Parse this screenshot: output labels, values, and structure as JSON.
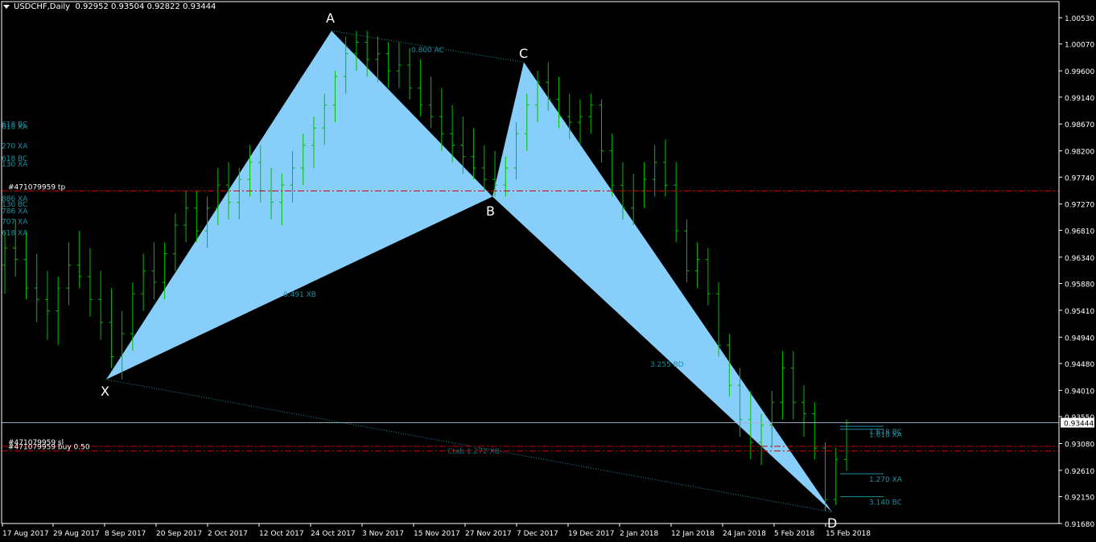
{
  "header": {
    "symbol": "USDCHF,Daily",
    "ohlc": "0.92952 0.93504 0.92822 0.93444"
  },
  "colors": {
    "background": "#000000",
    "candle": "#00c000",
    "pattern_fill": "#87cefa",
    "ratio_text": "#1e8fa0",
    "grid_label": "#ffffff",
    "order_line": "#cc0000",
    "bid_line": "#9fb4c8"
  },
  "price_axis": {
    "min": 0.9168,
    "max": 1.0053,
    "ticks": [
      "1.00530",
      "1.00070",
      "0.99600",
      "0.99140",
      "0.98670",
      "0.98200",
      "0.97740",
      "0.97270",
      "0.96810",
      "0.96340",
      "0.95880",
      "0.95410",
      "0.94940",
      "0.94480",
      "0.94010",
      "0.93550",
      "0.93080",
      "0.92610",
      "0.92150",
      "0.91680"
    ],
    "current_price": "0.93444"
  },
  "time_axis": {
    "labels": [
      "17 Aug 2017",
      "29 Aug 2017",
      "8 Sep 2017",
      "20 Sep 2017",
      "2 Oct 2017",
      "12 Oct 2017",
      "24 Oct 2017",
      "3 Nov 2017",
      "15 Nov 2017",
      "27 Nov 2017",
      "7 Dec 2017",
      "19 Dec 2017",
      "2 Jan 2018",
      "12 Jan 2018",
      "24 Jan 2018",
      "5 Feb 2018",
      "15 Feb 2018"
    ]
  },
  "pattern": {
    "points": [
      {
        "label": "X",
        "price": 0.942
      },
      {
        "label": "A",
        "price": 1.003
      },
      {
        "label": "B",
        "price": 0.974
      },
      {
        "label": "C",
        "price": 0.9975
      },
      {
        "label": "D",
        "price": 0.9188
      }
    ],
    "ratios": {
      "xb": "0.491 XB",
      "ac": "0.800 AC",
      "bd": "3.255 BD"
    },
    "d_levels": [
      {
        "label": "1.618 BC",
        "price": 0.9338
      },
      {
        "label": "1.618 XA",
        "price": 0.9333
      },
      {
        "label": "1.270 XA",
        "price": 0.9255
      },
      {
        "label": "3.140 BC",
        "price": 0.9215
      }
    ],
    "left_levels": [
      {
        "label": "618 BC",
        "price": 0.9868
      },
      {
        "label": "618 XA",
        "price": 0.9864
      },
      {
        "label": "270 XA",
        "price": 0.983
      },
      {
        "label": "618 BC",
        "price": 0.9808
      },
      {
        "label": "130 XA",
        "price": 0.9798
      },
      {
        "label": "886 XA",
        "price": 0.9738
      },
      {
        "label": "130 BC",
        "price": 0.9728
      },
      {
        "label": "786 XA",
        "price": 0.9716
      },
      {
        "label": "707 XA",
        "price": 0.9698
      },
      {
        "label": "618 XA",
        "price": 0.9678
      }
    ],
    "x_extension_label": "Ctab  1.272 XB"
  },
  "orders": [
    {
      "label": "#471079959 tp",
      "price": 0.975
    },
    {
      "label": "#471079959 sl",
      "price": 0.9303
    },
    {
      "label": "#471079959 buy 0.50",
      "price": 0.9295
    }
  ],
  "chart_data": {
    "type": "bar",
    "title": "USDCHF,Daily",
    "xlabel": "",
    "ylabel": "",
    "ylim": [
      0.9168,
      1.0053
    ],
    "categories": [
      "17 Aug 2017",
      "29 Aug 2017",
      "8 Sep 2017",
      "20 Sep 2017",
      "2 Oct 2017",
      "12 Oct 2017",
      "24 Oct 2017",
      "3 Nov 2017",
      "15 Nov 2017",
      "27 Nov 2017",
      "7 Dec 2017",
      "19 Dec 2017",
      "2 Jan 2018",
      "12 Jan 2018",
      "24 Jan 2018",
      "5 Feb 2018",
      "15 Feb 2018"
    ],
    "series": [
      {
        "name": "USDCHF",
        "values": [
          [
            0.962,
            0.968,
            0.957,
            0.965
          ],
          [
            0.965,
            0.97,
            0.96,
            0.963
          ],
          [
            0.963,
            0.968,
            0.956,
            0.958
          ],
          [
            0.958,
            0.964,
            0.952,
            0.956
          ],
          [
            0.956,
            0.961,
            0.949,
            0.954
          ],
          [
            0.954,
            0.96,
            0.948,
            0.958
          ],
          [
            0.958,
            0.966,
            0.955,
            0.962
          ],
          [
            0.962,
            0.968,
            0.958,
            0.96
          ],
          [
            0.96,
            0.965,
            0.953,
            0.956
          ],
          [
            0.956,
            0.961,
            0.949,
            0.952
          ],
          [
            0.952,
            0.958,
            0.944,
            0.946
          ],
          [
            0.946,
            0.954,
            0.942,
            0.95
          ],
          [
            0.95,
            0.959,
            0.947,
            0.957
          ],
          [
            0.957,
            0.964,
            0.954,
            0.961
          ],
          [
            0.961,
            0.966,
            0.956,
            0.959
          ],
          [
            0.959,
            0.966,
            0.956,
            0.964
          ],
          [
            0.964,
            0.971,
            0.961,
            0.969
          ],
          [
            0.969,
            0.975,
            0.966,
            0.972
          ],
          [
            0.972,
            0.975,
            0.966,
            0.968
          ],
          [
            0.968,
            0.974,
            0.965,
            0.972
          ],
          [
            0.972,
            0.979,
            0.969,
            0.976
          ],
          [
            0.976,
            0.98,
            0.97,
            0.973
          ],
          [
            0.973,
            0.979,
            0.97,
            0.977
          ],
          [
            0.977,
            0.983,
            0.974,
            0.98
          ],
          [
            0.98,
            0.983,
            0.973,
            0.975
          ],
          [
            0.975,
            0.979,
            0.97,
            0.973
          ],
          [
            0.973,
            0.978,
            0.969,
            0.976
          ],
          [
            0.976,
            0.982,
            0.973,
            0.979
          ],
          [
            0.979,
            0.985,
            0.976,
            0.983
          ],
          [
            0.983,
            0.988,
            0.979,
            0.986
          ],
          [
            0.986,
            0.992,
            0.983,
            0.99
          ],
          [
            0.99,
            0.996,
            0.987,
            0.995
          ],
          [
            0.995,
            1.002,
            0.992,
            0.999
          ],
          [
            0.999,
            1.003,
            0.996,
            1.001
          ],
          [
            1.001,
            1.003,
            0.995,
            0.998
          ],
          [
            0.998,
            1.002,
            0.994,
            0.999
          ],
          [
            0.999,
            1.001,
            0.993,
            0.996
          ],
          [
            0.996,
            1.001,
            0.993,
            0.997
          ],
          [
            0.997,
            1.0,
            0.991,
            0.993
          ],
          [
            0.993,
            0.998,
            0.988,
            0.99
          ],
          [
            0.99,
            0.995,
            0.986,
            0.988
          ],
          [
            0.988,
            0.993,
            0.982,
            0.985
          ],
          [
            0.985,
            0.99,
            0.98,
            0.983
          ],
          [
            0.983,
            0.988,
            0.978,
            0.981
          ],
          [
            0.981,
            0.986,
            0.977,
            0.979
          ],
          [
            0.979,
            0.983,
            0.975,
            0.977
          ],
          [
            0.977,
            0.982,
            0.974,
            0.976
          ],
          [
            0.976,
            0.981,
            0.974,
            0.979
          ],
          [
            0.979,
            0.987,
            0.977,
            0.985
          ],
          [
            0.985,
            0.992,
            0.982,
            0.99
          ],
          [
            0.99,
            0.996,
            0.987,
            0.994
          ],
          [
            0.994,
            0.9975,
            0.989,
            0.991
          ],
          [
            0.991,
            0.995,
            0.986,
            0.988
          ],
          [
            0.988,
            0.992,
            0.984,
            0.987
          ],
          [
            0.987,
            0.991,
            0.983,
            0.988
          ],
          [
            0.988,
            0.992,
            0.985,
            0.99
          ],
          [
            0.99,
            0.991,
            0.98,
            0.982
          ],
          [
            0.982,
            0.985,
            0.974,
            0.976
          ],
          [
            0.976,
            0.98,
            0.97,
            0.972
          ],
          [
            0.972,
            0.978,
            0.969,
            0.975
          ],
          [
            0.975,
            0.98,
            0.972,
            0.977
          ],
          [
            0.977,
            0.983,
            0.974,
            0.98
          ],
          [
            0.98,
            0.984,
            0.974,
            0.976
          ],
          [
            0.976,
            0.98,
            0.966,
            0.968
          ],
          [
            0.968,
            0.97,
            0.959,
            0.961
          ],
          [
            0.961,
            0.966,
            0.958,
            0.963
          ],
          [
            0.963,
            0.965,
            0.955,
            0.957
          ],
          [
            0.957,
            0.959,
            0.946,
            0.948
          ],
          [
            0.948,
            0.95,
            0.939,
            0.941
          ],
          [
            0.941,
            0.944,
            0.932,
            0.935
          ],
          [
            0.935,
            0.94,
            0.928,
            0.931
          ],
          [
            0.931,
            0.936,
            0.927,
            0.934
          ],
          [
            0.934,
            0.94,
            0.93,
            0.938
          ],
          [
            0.938,
            0.947,
            0.935,
            0.944
          ],
          [
            0.944,
            0.947,
            0.935,
            0.938
          ],
          [
            0.938,
            0.941,
            0.932,
            0.936
          ],
          [
            0.936,
            0.938,
            0.928,
            0.93
          ],
          [
            0.93,
            0.931,
            0.919,
            0.921
          ],
          [
            0.921,
            0.93,
            0.92,
            0.928
          ],
          [
            0.928,
            0.935,
            0.926,
            0.9344
          ]
        ]
      }
    ],
    "grid": false,
    "legend": "none"
  }
}
